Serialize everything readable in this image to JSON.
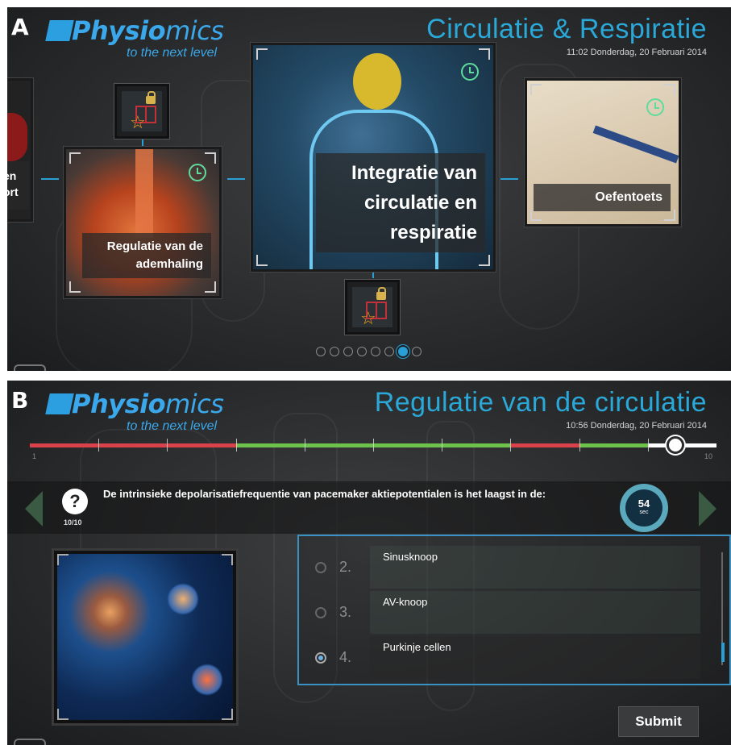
{
  "panel_a": {
    "letter": "A",
    "logo": {
      "bold": "Physio",
      "rest": "mics",
      "tagline": "to the next level"
    },
    "title": "Circulatie & Respiratie",
    "datetime": "11:02 Donderdag, 20 Februari 2014",
    "cards": {
      "left_partial": "en\nort",
      "left": "Regulatie van de ademhaling",
      "center": "Integratie van circulatie en respiratie",
      "right": "Oefentoets"
    },
    "pagination": {
      "total": 8,
      "active_index": 6
    }
  },
  "panel_b": {
    "letter": "B",
    "logo": {
      "bold": "Physio",
      "rest": "mics",
      "tagline": "to the next level"
    },
    "title": "Regulatie van de circulatie",
    "datetime": "10:56 Donderdag, 20 Februari 2014",
    "progress": {
      "start_label": "1",
      "end_label": "10",
      "current": 10,
      "total": 10,
      "segments": [
        "wrong",
        "wrong",
        "wrong",
        "correct",
        "correct",
        "correct",
        "correct",
        "wrong",
        "correct",
        "current"
      ],
      "colors": {
        "wrong": "#d9414b",
        "correct": "#6cc24a",
        "current": "#ffffff"
      }
    },
    "question": {
      "icon": "?",
      "counter": "10/10",
      "text": "De intrinsieke depolarisatiefrequentie van pacemaker aktiepotentialen is het laagst in de:"
    },
    "timer": {
      "value": "54",
      "unit": "sec"
    },
    "answers": [
      {
        "number": "2.",
        "text": "Sinusknoop",
        "selected": false
      },
      {
        "number": "3.",
        "text": "AV-knoop",
        "selected": false
      },
      {
        "number": "4.",
        "text": "Purkinje cellen",
        "selected": true
      }
    ],
    "submit_label": "Submit"
  },
  "colors": {
    "accent": "#2a9fd6",
    "clock": "#5fdc9c"
  }
}
